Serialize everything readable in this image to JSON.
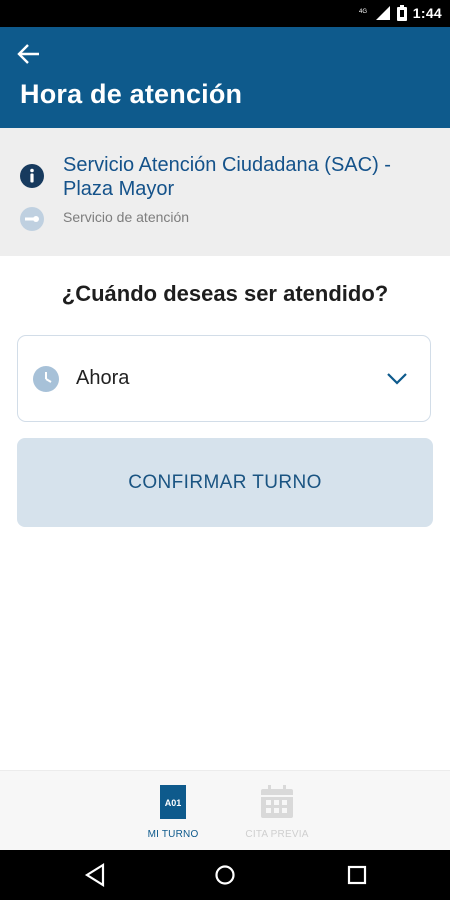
{
  "status_bar": {
    "time": "1:44",
    "icons": [
      "network-4g-icon",
      "signal-icon",
      "battery-icon"
    ]
  },
  "app_bar": {
    "title": "Hora de atención",
    "back_icon": "arrow-left-icon"
  },
  "service": {
    "name": "Servicio Atención Ciudadana (SAC) - Plaza Mayor",
    "type": "Servicio de atención"
  },
  "main": {
    "question": "¿Cuándo deseas ser atendido?",
    "time_select": {
      "selected": "Ahora"
    },
    "confirm_label": "CONFIRMAR TURNO"
  },
  "bottom_nav": {
    "items": [
      {
        "label": "MI TURNO",
        "badge": "A01",
        "active": true
      },
      {
        "label": "CITA PREVIA",
        "active": false
      }
    ]
  },
  "colors": {
    "primary": "#0e5a8c",
    "service_text": "#14528a",
    "button_bg": "#d6e2ec",
    "panel_bg": "#eeeeee"
  }
}
